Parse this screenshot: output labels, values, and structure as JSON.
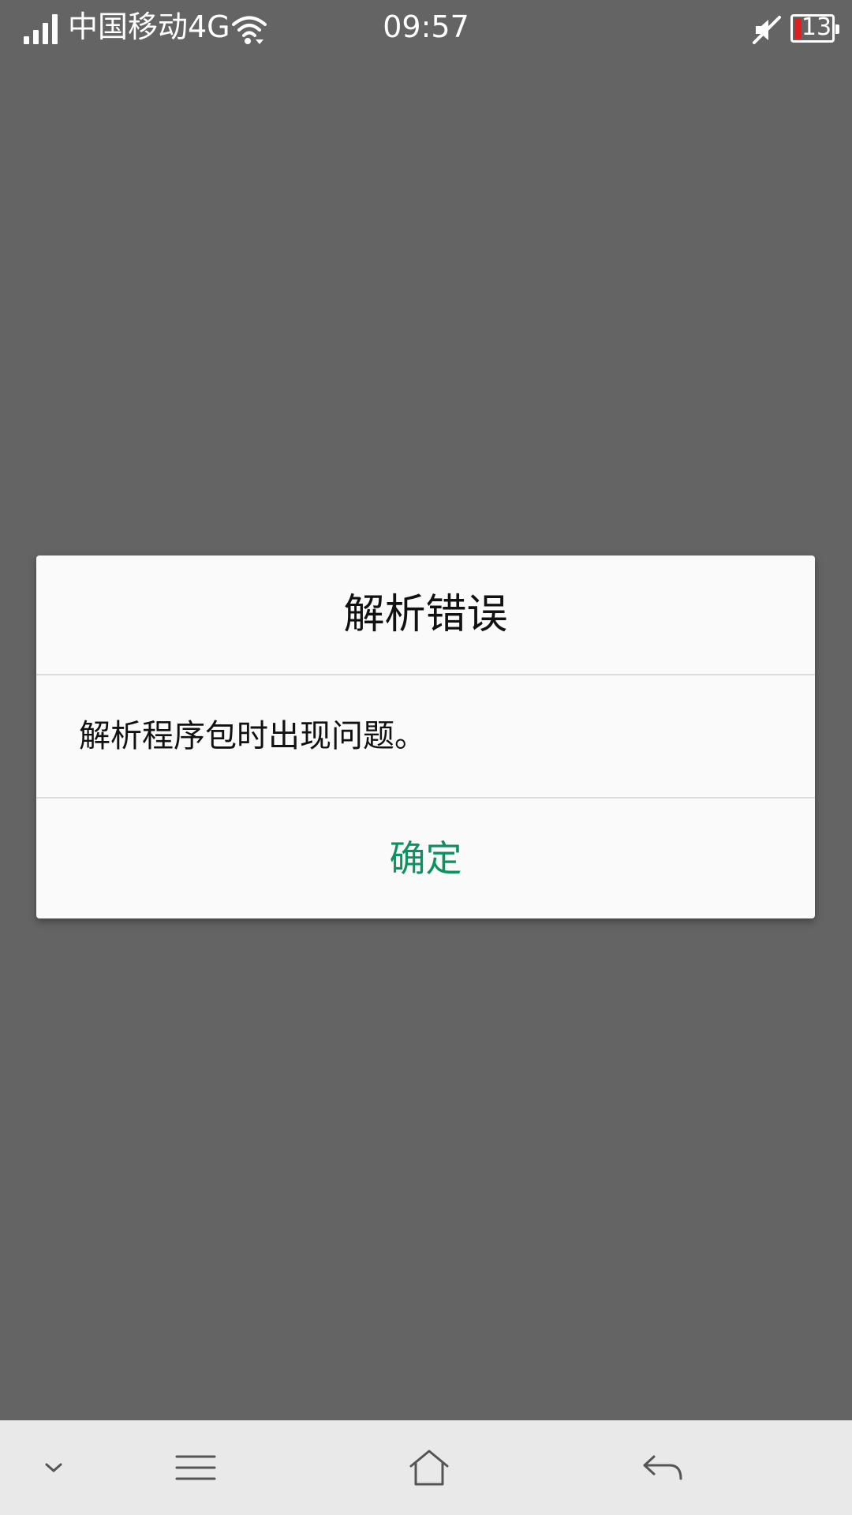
{
  "status_bar": {
    "carrier": "中国移动4G",
    "time": "09:57",
    "battery_level": "13",
    "icons": [
      "signal-icon",
      "wifi-icon",
      "mute-icon",
      "battery-icon"
    ]
  },
  "dialog": {
    "title": "解析错误",
    "message": "解析程序包时出现问题。",
    "confirm_label": "确定",
    "accent_color": "#0c9160"
  },
  "nav_bar": {
    "icons": [
      "chevron-down-icon",
      "menu-icon",
      "home-icon",
      "back-icon"
    ]
  },
  "colors": {
    "scrim": "#646464",
    "dialog_bg": "#fafafa",
    "nav_bg": "#e9e9e9",
    "battery_low": "#e02020"
  }
}
